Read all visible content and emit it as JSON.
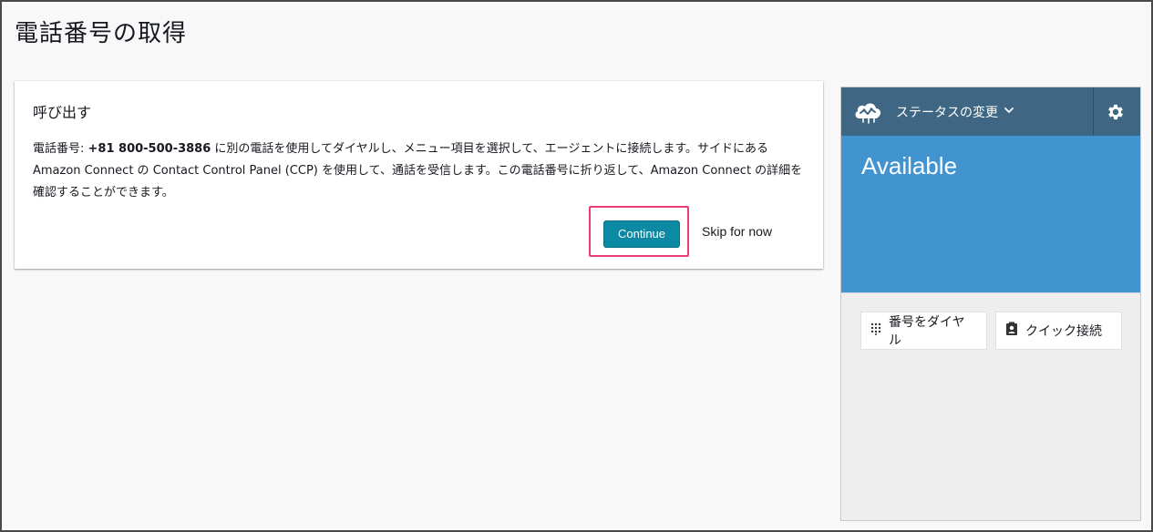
{
  "page": {
    "title": "電話番号の取得"
  },
  "callout": {
    "title": "呼び出す",
    "body_prefix": "電話番号: ",
    "phone_number": "+81 800-500-3886",
    "body_suffix": " に別の電話を使用してダイヤルし、メニュー項目を選択して、エージェントに接続します。サイドにある Amazon Connect の Contact Control Panel (CCP) を使用して、通話を受信します。この電話番号に折り返して、Amazon Connect の詳細を確認することができます。",
    "continue_label": "Continue",
    "skip_label": "Skip for now"
  },
  "ccp": {
    "status_change_label": "ステータスの変更",
    "status": "Available",
    "dial_number_label": "番号をダイヤル",
    "quick_connect_label": "クイック接続",
    "icons": {
      "logo": "cloud-logo-icon",
      "dropdown": "chevron-down-icon",
      "settings": "gear-icon",
      "dialpad": "dialpad-icon",
      "quick_connect": "contact-card-icon"
    }
  },
  "colors": {
    "header_bg": "#3f6682",
    "status_bg": "#4294d0",
    "continue_bg": "#0c8aa4",
    "highlight": "#ec3b7d"
  }
}
